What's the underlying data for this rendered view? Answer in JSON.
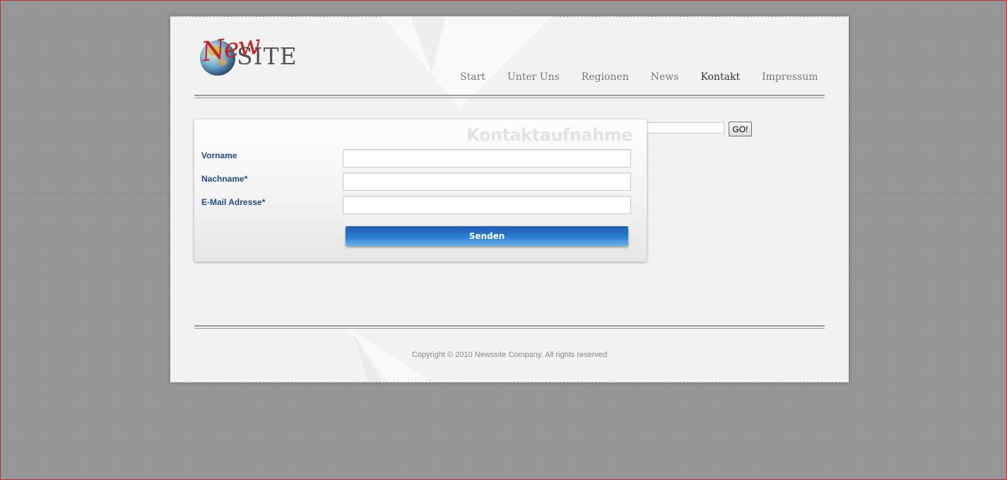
{
  "logo": {
    "new_text": "New",
    "site_text": "SITE"
  },
  "nav": {
    "items": [
      {
        "label": "Start",
        "active": false
      },
      {
        "label": "Unter Uns",
        "active": false
      },
      {
        "label": "Regionen",
        "active": false
      },
      {
        "label": "News",
        "active": false
      },
      {
        "label": "Kontakt",
        "active": true
      },
      {
        "label": "Impressum",
        "active": false
      }
    ]
  },
  "search": {
    "value": "",
    "button_label": "GO!"
  },
  "contact_form": {
    "title": "Kontaktaufnahme",
    "fields": [
      {
        "label": "Vorname",
        "value": ""
      },
      {
        "label": "Nachname*",
        "value": ""
      },
      {
        "label": "E-Mail Adresse*",
        "value": ""
      }
    ],
    "submit_label": "Senden"
  },
  "footer": {
    "copyright": "Copyright © 2010 Newssite Company. All rights reserved"
  },
  "colors": {
    "background": "#8f8f8f",
    "sheet": "#f2f2f2",
    "label_blue": "#234a84",
    "button_blue": "#2a7fd4",
    "logo_red": "#cc2222"
  }
}
